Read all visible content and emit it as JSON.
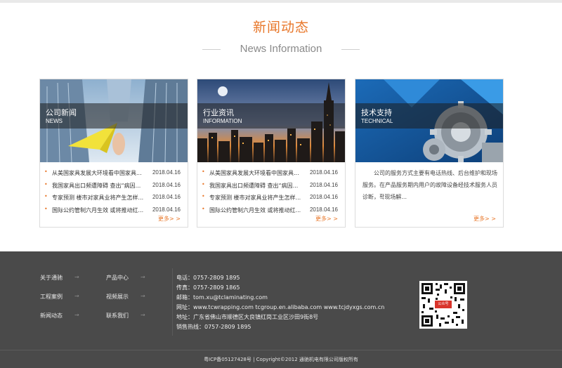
{
  "section": {
    "title": "新闻动态",
    "subtitle": "News Information"
  },
  "cards": [
    {
      "cn": "公司新闻",
      "en": "NEWS",
      "items": [
        {
          "title": "从美国家具发展大环境看中国家具...",
          "date": "2018.04.16"
        },
        {
          "title": "我国家具出口频遭障碍 查出“病因...",
          "date": "2018.04.16"
        },
        {
          "title": "专家预测 楼市对家具业将产生怎样...",
          "date": "2018.04.16"
        },
        {
          "title": "国际公约管制六月生效 或将推动红...",
          "date": "2018.04.16"
        }
      ],
      "more": "更多> >"
    },
    {
      "cn": "行业资讯",
      "en": "INFORMATION",
      "items": [
        {
          "title": "从美国家具发展大环境看中国家具...",
          "date": "2018.04.16"
        },
        {
          "title": "我国家具出口频遭障碍 查出“病因...",
          "date": "2018.04.16"
        },
        {
          "title": "专家预测 楼市对家具业将产生怎样...",
          "date": "2018.04.16"
        },
        {
          "title": "国际公约管制六月生效 或将推动红...",
          "date": "2018.04.16"
        }
      ],
      "more": "更多> >"
    },
    {
      "cn": "技术支持",
      "en": "TECHNICAL",
      "text": "公司的服务方式主要有电话热线、后台维护和现场服务。在产品服务期内用户的故障设备经技术服务人员诊断，확现场解...",
      "more": "更多> >"
    }
  ],
  "footer": {
    "nav": [
      {
        "label": "关于通驰",
        "arrow": "→"
      },
      {
        "label": "产品中心",
        "arrow": "→"
      },
      {
        "label": "工程案例",
        "arrow": "→"
      },
      {
        "label": "视频展示",
        "arrow": "→"
      },
      {
        "label": "新闻动态",
        "arrow": "→"
      },
      {
        "label": "联系我们",
        "arrow": "→"
      }
    ],
    "contact": [
      "电话：0757-2809 1895",
      "传真：0757-2809 1865",
      "邮箱：tom.xu@tclaminating.com",
      "网址：www.tcwrapping.com    tcgroup.en.alibaba.com    www.tcjdyxgs.com.cn",
      "地址：广东省佛山市顺德区大良镇红岗工业区沙田9街8号",
      "销售热线：0757-2809 1895"
    ],
    "qr_badge": "公众号",
    "copyright": "粤ICP备05127428号 | Copyright©2012 通驰机电有限公司版权所有"
  },
  "colors": {
    "accent": "#e8772a",
    "footer_bg": "#4a4a4a"
  }
}
